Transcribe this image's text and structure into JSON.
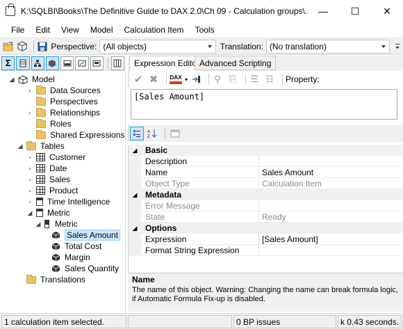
{
  "window": {
    "title": "K:\\SQLBI\\Books\\The Definitive Guide to DAX 2.0\\Ch 09 - Calculation groups\\...",
    "minimize_glyph": "—",
    "maximize_glyph": "☐",
    "close_glyph": "✕"
  },
  "menu": [
    "File",
    "Edit",
    "View",
    "Model",
    "Calculation Item",
    "Tools"
  ],
  "toolbar": {
    "perspective_label": "Perspective:",
    "perspective_value": "(All objects)",
    "translation_label": "Translation:",
    "translation_value": "(No translation)"
  },
  "tree": {
    "model": "Model",
    "data_sources": "Data Sources",
    "perspectives": "Perspectives",
    "relationships": "Relationships",
    "roles": "Roles",
    "shared_expressions": "Shared Expressions",
    "tables": "Tables",
    "customer": "Customer",
    "date": "Date",
    "sales": "Sales",
    "product": "Product",
    "time_intelligence": "Time Intelligence",
    "metric_table": "Metric",
    "metric_column": "Metric",
    "sales_amount": "Sales Amount",
    "total_cost": "Total Cost",
    "margin": "Margin",
    "sales_quantity": "Sales Quantity",
    "translations": "Translations"
  },
  "tabs": {
    "expression_editor": "Expression Editor",
    "advanced_scripting": "Advanced Scripting"
  },
  "expression_toolbar": {
    "dax_label": "DAX",
    "property_label": "Property:"
  },
  "expression": "[Sales Amount]",
  "property_grid": {
    "basic": "Basic",
    "description_name": "Description",
    "description_value": "",
    "name_name": "Name",
    "name_value": "Sales Amount",
    "object_type_name": "Object Type",
    "object_type_value": "Calculation Item",
    "metadata": "Metadata",
    "error_message_name": "Error Message",
    "error_message_value": "",
    "state_name": "State",
    "state_value": "Ready",
    "options": "Options",
    "expression_name": "Expression",
    "expression_value": "[Sales Amount]",
    "format_string_name": "Format String Expression",
    "format_string_value": ""
  },
  "description": {
    "title": "Name",
    "text": "The name of this object. Warning: Changing the name can break formula logic, if Automatic Formula Fix-up is disabled."
  },
  "status": {
    "selection": "1 calculation item selected.",
    "bp_issues": "0 BP issues",
    "timing": "k 0.43 seconds."
  }
}
